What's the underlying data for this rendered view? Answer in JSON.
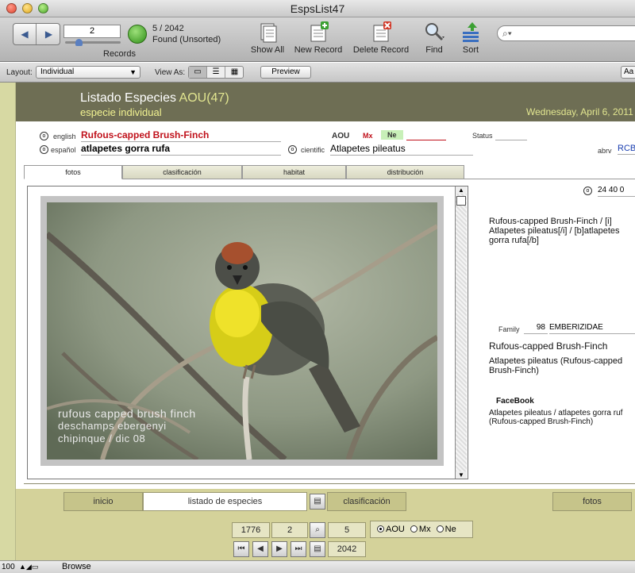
{
  "window": {
    "title": "EspsList47"
  },
  "toolbar": {
    "record_input": "2",
    "record_count": "5 / 2042",
    "found_status": "Found (Unsorted)",
    "records_label": "Records",
    "show_all": "Show All",
    "new_record": "New Record",
    "delete_record": "Delete Record",
    "find": "Find",
    "sort": "Sort"
  },
  "layoutbar": {
    "layout_label": "Layout:",
    "layout_value": "Individual",
    "view_as_label": "View As:",
    "preview": "Preview",
    "aa": "Aa"
  },
  "header": {
    "title": "Listado Especies",
    "aou": "AOU(47)",
    "subtitle": "especie individual",
    "date": "Wednesday, April 6, 2011"
  },
  "fields": {
    "english_label": "english",
    "english_value": "Rufous-capped Brush-Finch",
    "espanol_label": "español",
    "espanol_value": "atlapetes gorra rufa",
    "aou_label": "AOU",
    "mx_label": "Mx",
    "ne_label": "Ne",
    "status_label": "Status",
    "cientific_label": "cientific",
    "cientific_value": "Atlapetes pileatus",
    "abrv_label": "abrv",
    "abrv_value": "RCB",
    "code_value": "24 40 0"
  },
  "tabs": [
    "fotos",
    "clasificación",
    "habitat",
    "distribución"
  ],
  "photo": {
    "caption_lines": [
      "rufous capped brush finch",
      "deschamps ebergenyi",
      "chipinque / dic 08"
    ]
  },
  "right_panel": {
    "caption_lines": [
      "Rufous-capped Brush-Finch / [i]",
      "Atlapetes pileatus[/i] / [b]atlapetes",
      "gorra rufa[/b]"
    ],
    "family_label": "Family",
    "family_number": "98",
    "family_name": "EMBERIZIDAE",
    "english_red": "Rufous-capped Brush-Finch",
    "scientific_line1": "Atlapetes pileatus (Rufous-capped",
    "scientific_line2": "Brush-Finch)",
    "facebook_label": "FaceBook",
    "facebook_line1": "Atlapetes pileatus / atlapetes gorra ruf",
    "facebook_line2": "(Rufous-capped Brush-Finch)"
  },
  "bottom_nav": {
    "inicio": "inicio",
    "listado": "listado de especies",
    "clasificacion": "clasificación",
    "fotos": "fotos",
    "num1": "1776",
    "num2": "2",
    "num3": "5",
    "num4": "2042",
    "radio_aou": "AOU",
    "radio_mx": "Mx",
    "radio_ne": "Ne"
  },
  "statusbar": {
    "zoom": "100",
    "mode": "Browse"
  },
  "colors": {
    "header_bg": "#6e6e54",
    "accent_yellow": "#e2e690",
    "nav_bg": "#d4d29a",
    "red_text": "#c0121c"
  }
}
